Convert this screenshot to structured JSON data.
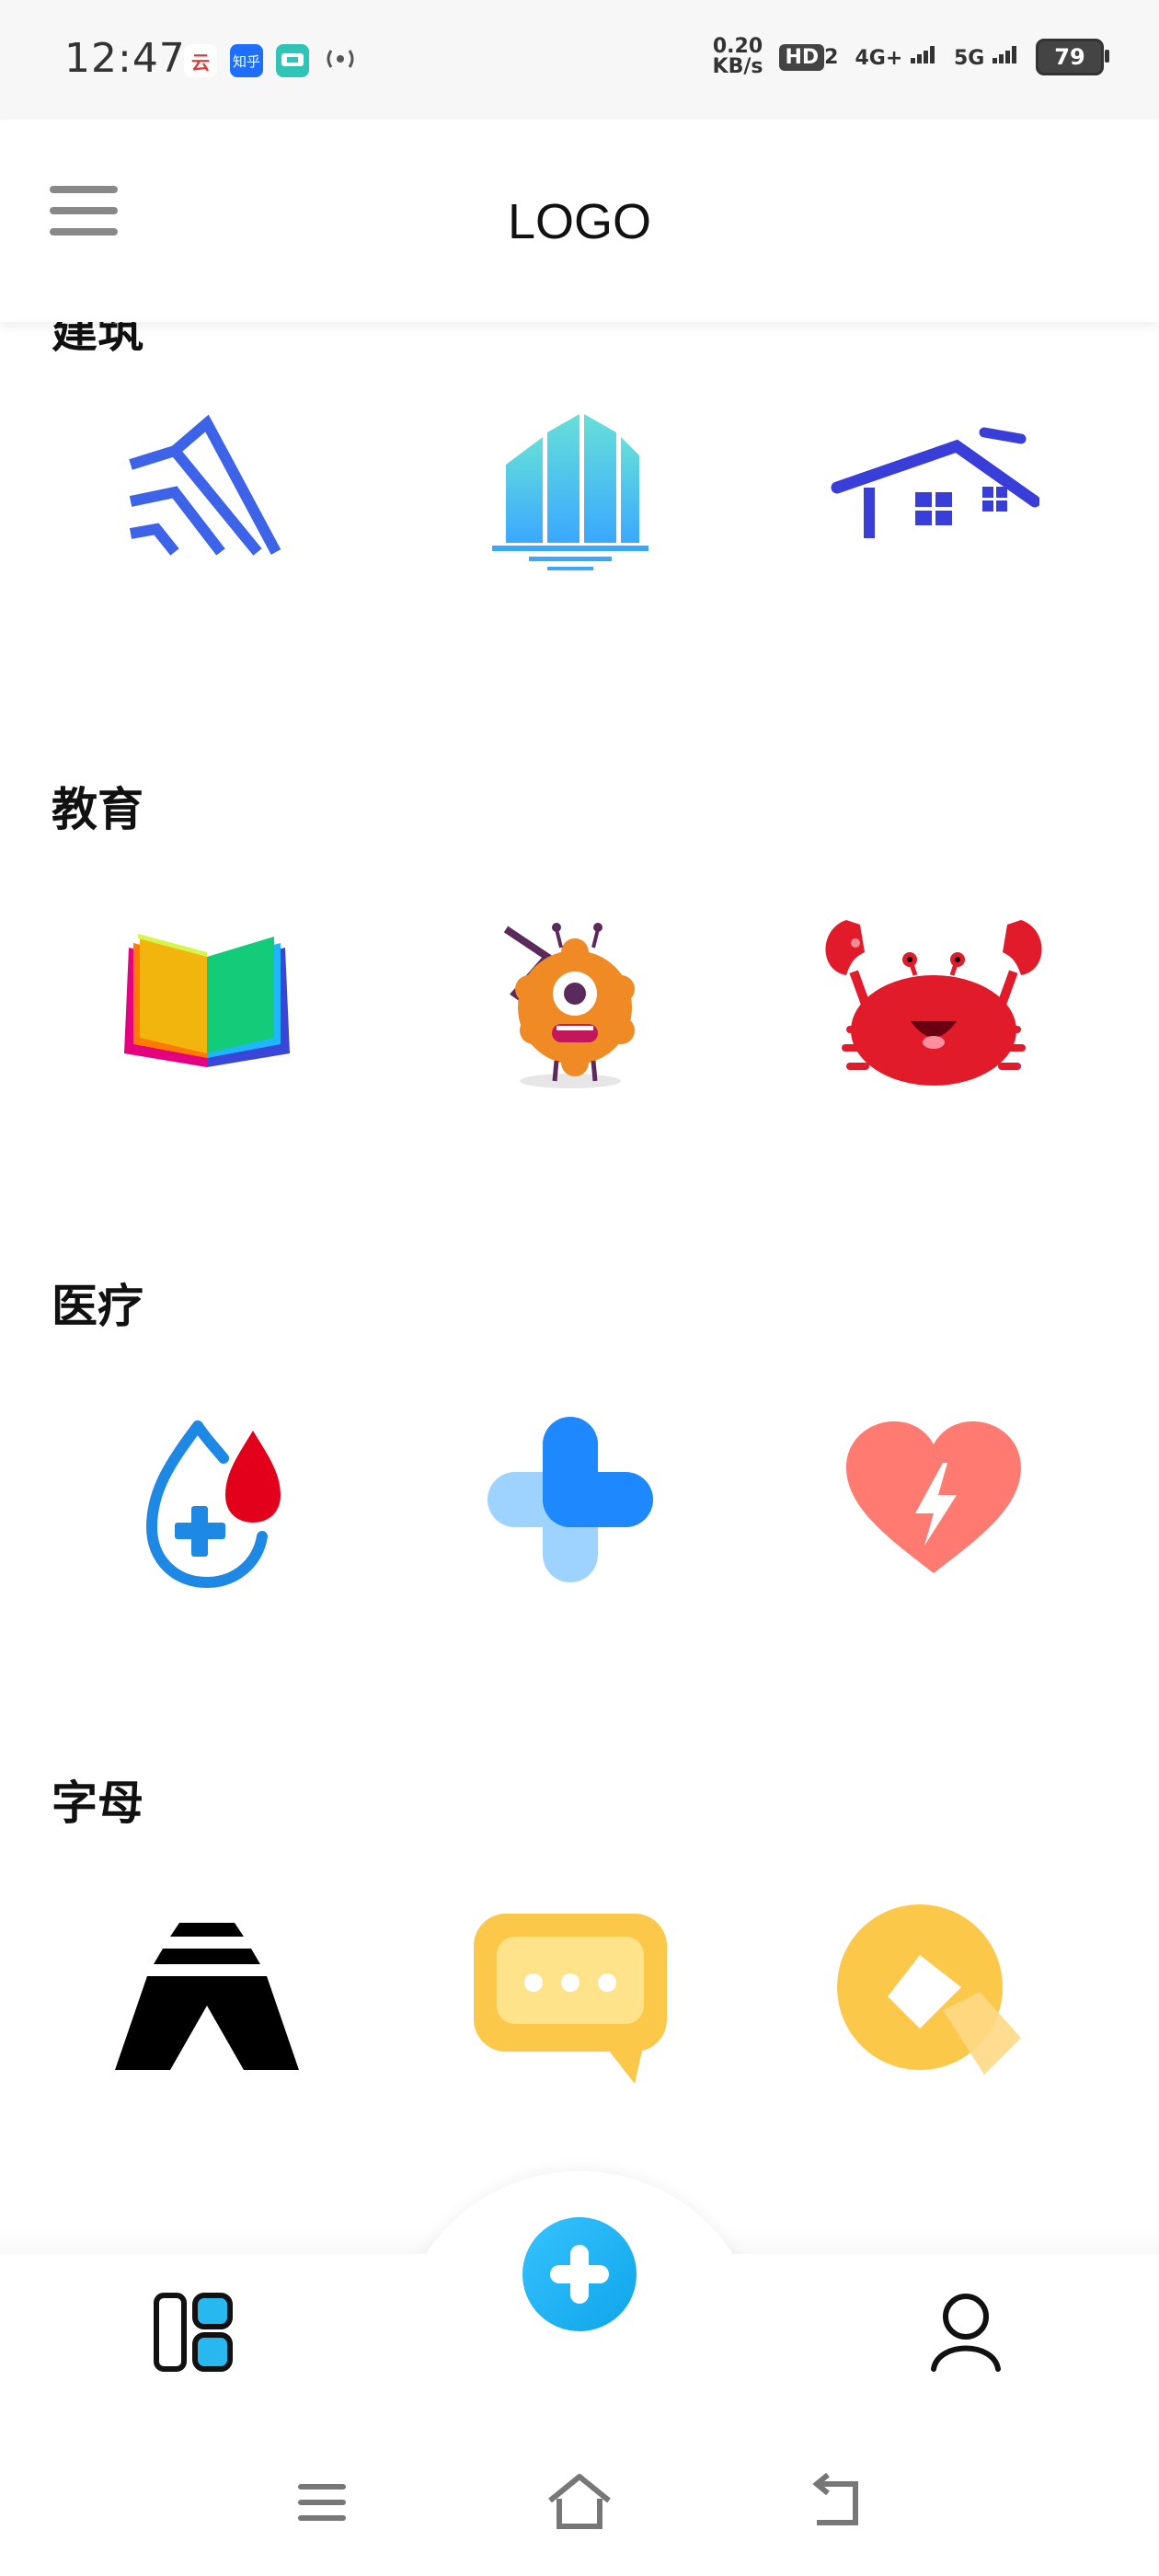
{
  "status_bar": {
    "time": "12:47",
    "net_speed_value": "0.20",
    "net_speed_unit": "KB/s",
    "hd": "HD",
    "hd_sub": "2",
    "signal1": "4G+",
    "signal2": "5G",
    "battery": "79",
    "notification_icons": [
      "yun-app-icon",
      "zhihu-app-icon",
      "video-app-icon",
      "hotspot-icon"
    ],
    "zhihu_label": "知乎",
    "yun_label": "云"
  },
  "header": {
    "title": "LOGO"
  },
  "sections": [
    {
      "title": "建筑",
      "logos": [
        "mountain-lines-logo",
        "blue-building-logo",
        "house-roof-logo"
      ]
    },
    {
      "title": "教育",
      "logos": [
        "open-book-logo",
        "orange-monster-logo",
        "red-crab-logo"
      ]
    },
    {
      "title": "医疗",
      "logos": [
        "blood-drop-cross-logo",
        "blue-plus-logo",
        "heart-bolt-logo"
      ]
    },
    {
      "title": "字母",
      "logos": [
        "letter-a-logo",
        "chat-bubble-logo",
        "yellow-q-logo"
      ]
    }
  ],
  "colors": {
    "accent_blue": "#0ea5e9",
    "building_blue": "#3b5bdb",
    "medical_blue": "#1e88e5",
    "heart_red": "#ff7b72",
    "yellow": "#fcc84a"
  }
}
